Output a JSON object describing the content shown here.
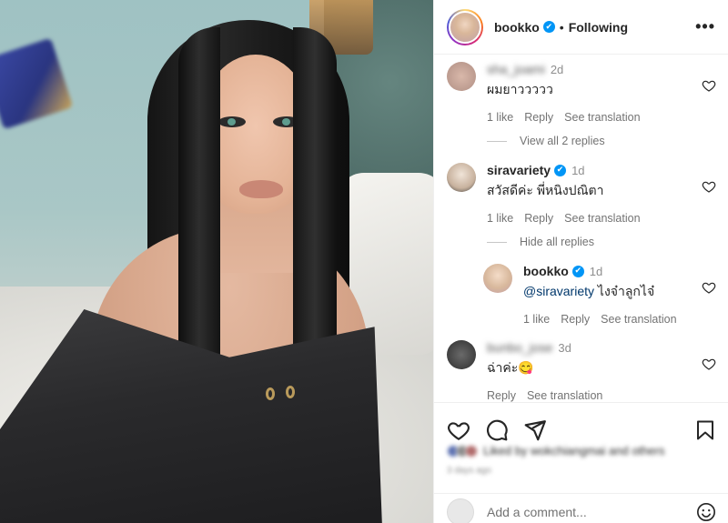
{
  "post": {
    "username": "bookko",
    "verified_mark": "✔",
    "separator": "•",
    "follow_status": "Following",
    "more_label": "•••"
  },
  "comments": [
    {
      "username": "sha_joami",
      "time": "2d",
      "text": "ผมยาววววว",
      "likes": "1 like",
      "reply": "Reply",
      "translate": "See translation",
      "avatar_color": "#c9a79a"
    },
    {
      "username": "siravariety",
      "verified": "✔",
      "time": "1d",
      "text": "สวัสดีค่ะ พี่หนิงปณิตา",
      "likes": "1 like",
      "reply": "Reply",
      "translate": "See translation",
      "avatar_color": "#d8c7b6"
    },
    {
      "username": "bookko",
      "verified": "✔",
      "time": "1d",
      "mention": "@siravariety",
      "text": " ไงจ๋าลูกไจ๋",
      "likes": "1 like",
      "reply": "Reply",
      "translate": "See translation",
      "avatar_color": "#e0c8b5"
    },
    {
      "username": "bunbo_jose",
      "time": "3d",
      "text": "ฉ่าค่ะ😋",
      "reply": "Reply",
      "translate": "See translation",
      "avatar_color": "#555555"
    }
  ],
  "threads": {
    "view_replies": "View all 2 replies",
    "hide_replies": "Hide all replies"
  },
  "likes_line": {
    "text": "Liked by wokchiangmai and others"
  },
  "date_line": "3 days ago",
  "comment_box": {
    "placeholder": "Add a comment..."
  },
  "colors": {
    "verified": "#0095f6",
    "muted": "#737373",
    "mention": "#00376b"
  }
}
